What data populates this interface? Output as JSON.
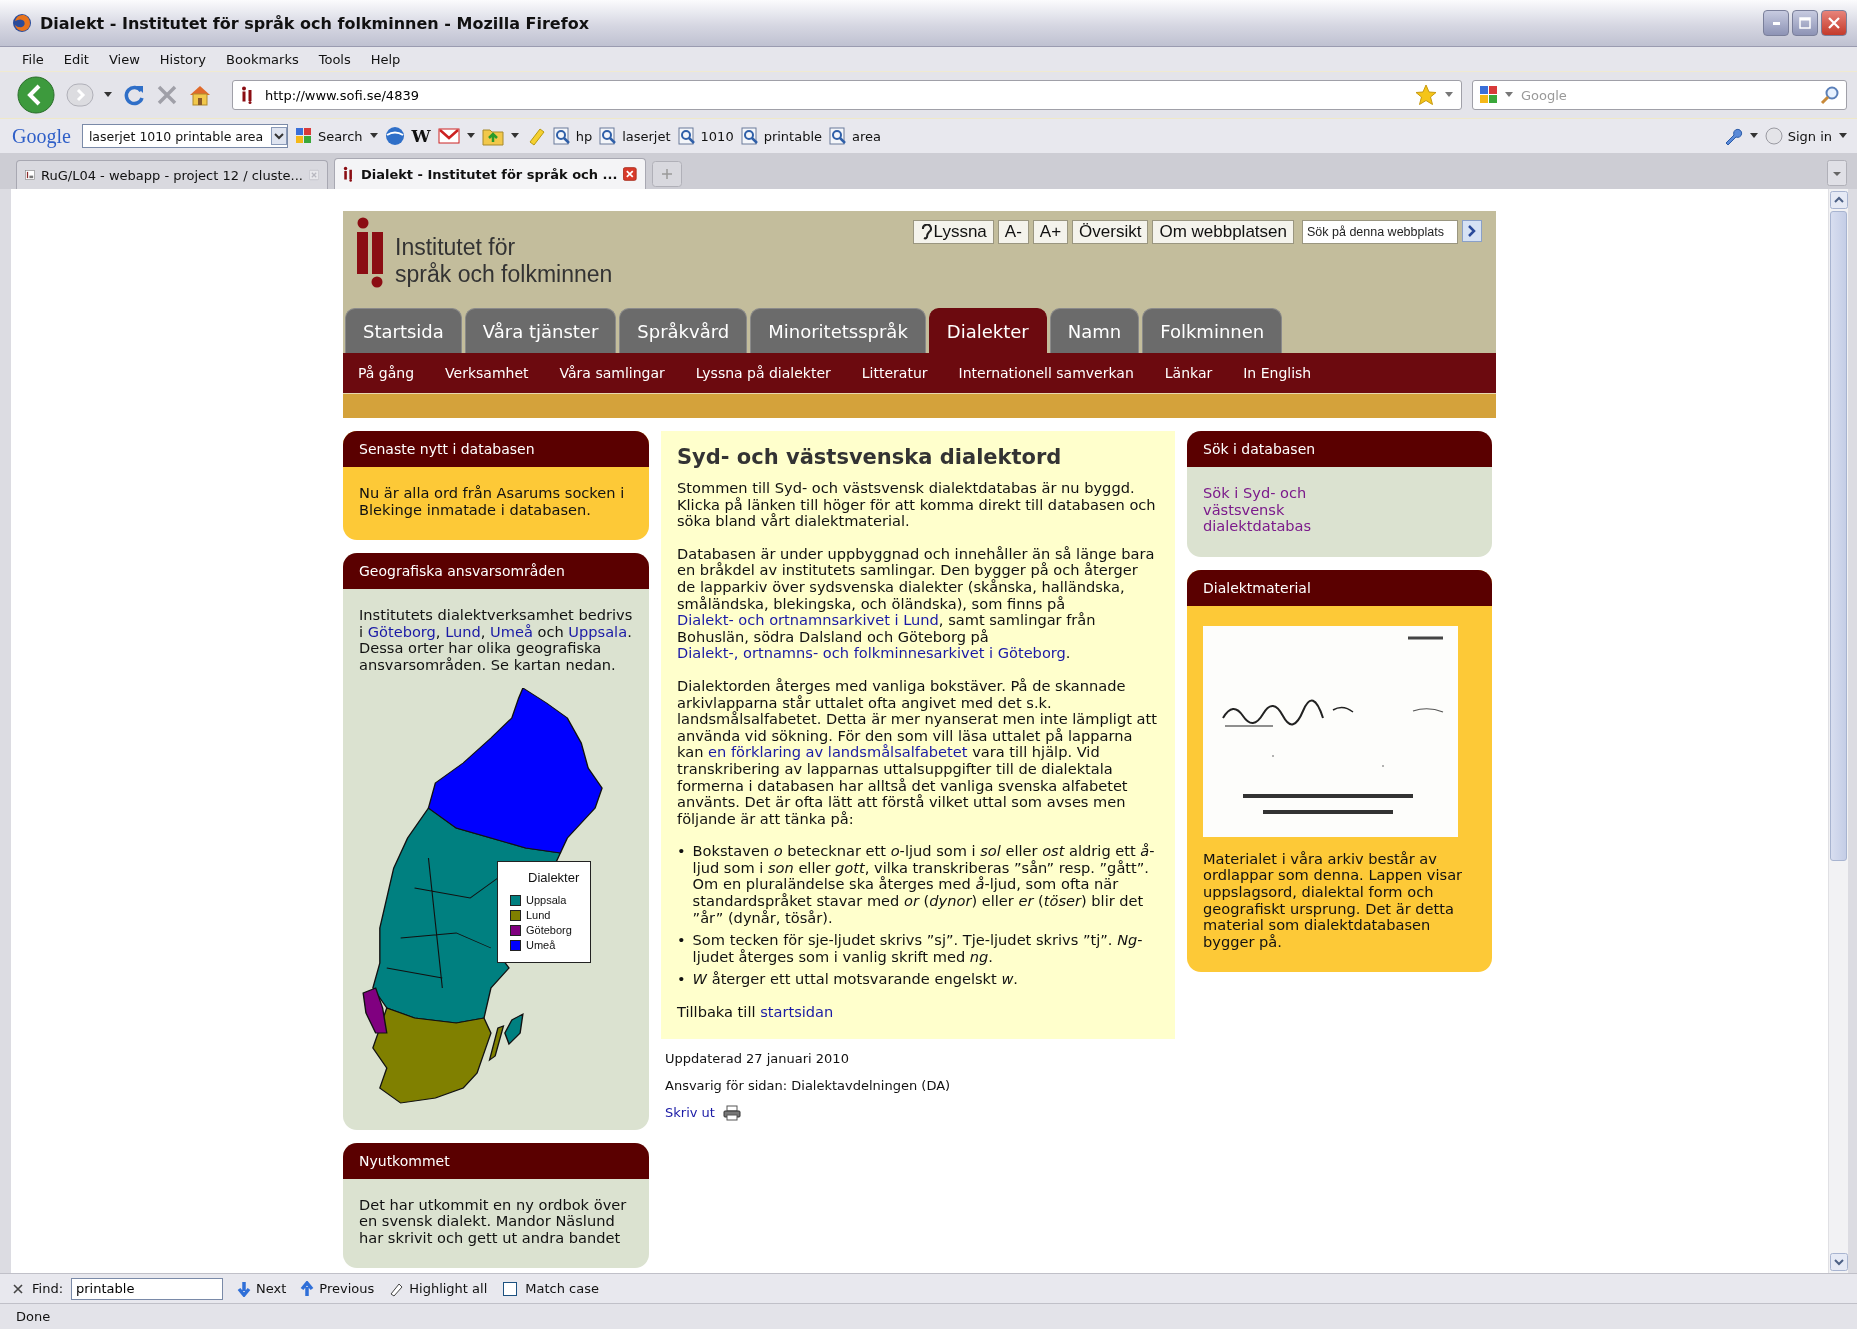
{
  "window": {
    "title": "Dialekt - Institutet för språk och folkminnen - Mozilla Firefox"
  },
  "menu": [
    "File",
    "Edit",
    "View",
    "History",
    "Bookmarks",
    "Tools",
    "Help"
  ],
  "navigation": {
    "url": "http://www.sofi.se/4839",
    "search_placeholder": "Google"
  },
  "google_toolbar": {
    "logo": "Google",
    "query": "laserjet 1010 printable area",
    "search_label": "Search",
    "letter_button": "W",
    "words": [
      "hp",
      "laserjet",
      "1010",
      "printable",
      "area"
    ],
    "sign_in": "Sign in"
  },
  "tabs": [
    {
      "label": "RuG/L04 - webapp - project 12 / cluste...",
      "selected": false
    },
    {
      "label": "Dialekt - Institutet för språk och ...",
      "selected": true
    }
  ],
  "site": {
    "logo": [
      "Institutet för",
      "språk och folkminnen"
    ],
    "tools": [
      "Lyssna",
      "A-",
      "A+",
      "Översikt",
      "Om webbplatsen"
    ],
    "site_search_placeholder": "Sök på denna webbplats",
    "main_tabs": [
      {
        "label": "Startsida",
        "selected": false
      },
      {
        "label": "Våra tjänster",
        "selected": false
      },
      {
        "label": "Språkvård",
        "selected": false
      },
      {
        "label": "Minoritetsspråk",
        "selected": false
      },
      {
        "label": "Dialekter",
        "selected": true
      },
      {
        "label": "Namn",
        "selected": false
      },
      {
        "label": "Folkminnen",
        "selected": false
      }
    ],
    "sub_nav": [
      "På gång",
      "Verksamhet",
      "Våra samlingar",
      "Lyssna på dialekter",
      "Litteratur",
      "Internationell samverkan",
      "Länkar",
      "In English"
    ],
    "left": [
      {
        "title": "Senaste nytt i databasen",
        "color": "#fdc937",
        "segments": [
          {
            "kind": "text",
            "text": "Nu är alla ord från Asarums socken i Blekinge inmatade i databasen."
          }
        ]
      },
      {
        "title": "Geografiska ansvarsområden",
        "color": "#dbe2d0",
        "segments": [
          {
            "kind": "text",
            "text": "Institutets dialektverksamhet bedrivs i "
          },
          {
            "kind": "link",
            "text": "Göteborg"
          },
          {
            "kind": "text",
            "text": ", "
          },
          {
            "kind": "link",
            "text": "Lund"
          },
          {
            "kind": "text",
            "text": ", "
          },
          {
            "kind": "link",
            "text": "Umeå"
          },
          {
            "kind": "text",
            "text": " och "
          },
          {
            "kind": "link",
            "text": "Uppsala"
          },
          {
            "kind": "text",
            "text": ". Dessa orter har olika geografiska ansvarsområden. Se kartan nedan."
          }
        ],
        "map": {
          "legend_title": "Dialekter",
          "regions": [
            {
              "name": "Uppsala",
              "color": "#008080"
            },
            {
              "name": "Lund",
              "color": "#808000"
            },
            {
              "name": "Göteborg",
              "color": "#800080"
            },
            {
              "name": "Umeå",
              "color": "#0000ff"
            }
          ]
        }
      },
      {
        "title": "Nyutkommet",
        "color": "#dbe2d0",
        "segments": [
          {
            "kind": "text",
            "text": "Det har utkommit en ny ordbok över en svensk dialekt. Mandor Näslund har skrivit och gett ut andra bandet"
          }
        ]
      }
    ],
    "article": {
      "heading": "Syd- och västsvenska dialektord",
      "paragraphs": [
        {
          "segments": [
            {
              "kind": "text",
              "text": "Stommen till Syd- och västsvensk dialektdatabas är nu byggd. Klicka på länken till höger för att komma direkt till databasen och söka bland vårt dialektmaterial."
            }
          ]
        },
        {
          "segments": [
            {
              "kind": "text",
              "text": "Databasen är under uppbyggnad och innehåller än så länge bara en bråkdel av institutets samlingar. Den bygger på och återger de lapparkiv över sydsvenska dialekter (skånska, halländska, småländska, blekingska, och öländska), som finns på "
            },
            {
              "kind": "link",
              "text": "Dialekt- och ortnamnsarkivet i Lund"
            },
            {
              "kind": "text",
              "text": ", samt samlingar från Bohuslän, södra Dalsland och Göteborg på "
            },
            {
              "kind": "link",
              "text": "Dialekt-, ortnamns- och folkminnesarkivet i Göteborg"
            },
            {
              "kind": "text",
              "text": "."
            }
          ]
        },
        {
          "segments": [
            {
              "kind": "text",
              "text": "Dialektorden återges med vanliga bokstäver. På de skannade arkivlapparna står uttalet ofta angivet med det s.k. landsmålsalfabetet. Detta är mer nyanserat men inte lämpligt att använda vid sökning. För den som vill läsa uttalet på lapparna kan "
            },
            {
              "kind": "link",
              "text": "en förklaring av landsmålsalfabetet"
            },
            {
              "kind": "text",
              "text": " vara till hjälp. Vid transkribering av lapparnas uttalsuppgifter till de dialektala formerna i databasen har alltså det vanliga svenska alfabetet använts. Det är ofta lätt att förstå vilket uttal som avses men följande är att tänka på:"
            }
          ]
        }
      ],
      "bullets": [
        {
          "marker": "•",
          "text": "Bokstaven *o* betecknar ett *o*-ljud som i *sol* eller *ost* aldrig ett *å*-ljud som i *son* eller *gott*, vilka transkriberas ”sån” resp. ”gått”. Om en pluraländelse ska återges med *å*-ljud, som ofta när standardspråket stavar med *or* (*dynor*) eller *er* (*töser*) blir det ”år” (dynår, tösår)."
        },
        {
          "marker": "•",
          "text": "Som tecken för sje-ljudet skrivs ”sj”. Tje-ljudet skrivs ”tj”. *Ng*-ljudet återges som i vanlig skrift med *ng*."
        },
        {
          "marker": "•",
          "text": "*W* återger ett uttal motsvarande engelskt *w*."
        }
      ],
      "back": [
        {
          "kind": "text",
          "text": "Tillbaka till "
        },
        {
          "kind": "link",
          "text": "startsidan"
        }
      ]
    },
    "footer": {
      "updated": "Uppdaterad 27 januari 2010",
      "responsible": "Ansvarig för sidan: Dialektavdelningen (DA)",
      "print": "Skriv ut"
    },
    "right": [
      {
        "title": "Sök i databasen",
        "color": "#dbe2d0",
        "segments": [
          {
            "kind": "visited_link",
            "text": "Sök i Syd- och västsvensk dialektdatabas"
          }
        ]
      },
      {
        "title": "Dialektmaterial",
        "color": "#fdc937",
        "image": {
          "kind": "picture"
        },
        "segments": [
          {
            "kind": "text",
            "text": "Materialet i våra arkiv består av ordlappar som denna. Lappen visar uppslagsord, dialektal form och geografiskt ursprung. Det är detta material som dialektdatabasen bygger på."
          }
        ]
      }
    ]
  },
  "find_bar": {
    "label": "Find:",
    "value": "printable",
    "next": "Next",
    "previous": "Previous",
    "highlight_all": "Highlight all",
    "match_case": {
      "label": "Match case",
      "checked": false
    }
  },
  "status_bar": "Done"
}
